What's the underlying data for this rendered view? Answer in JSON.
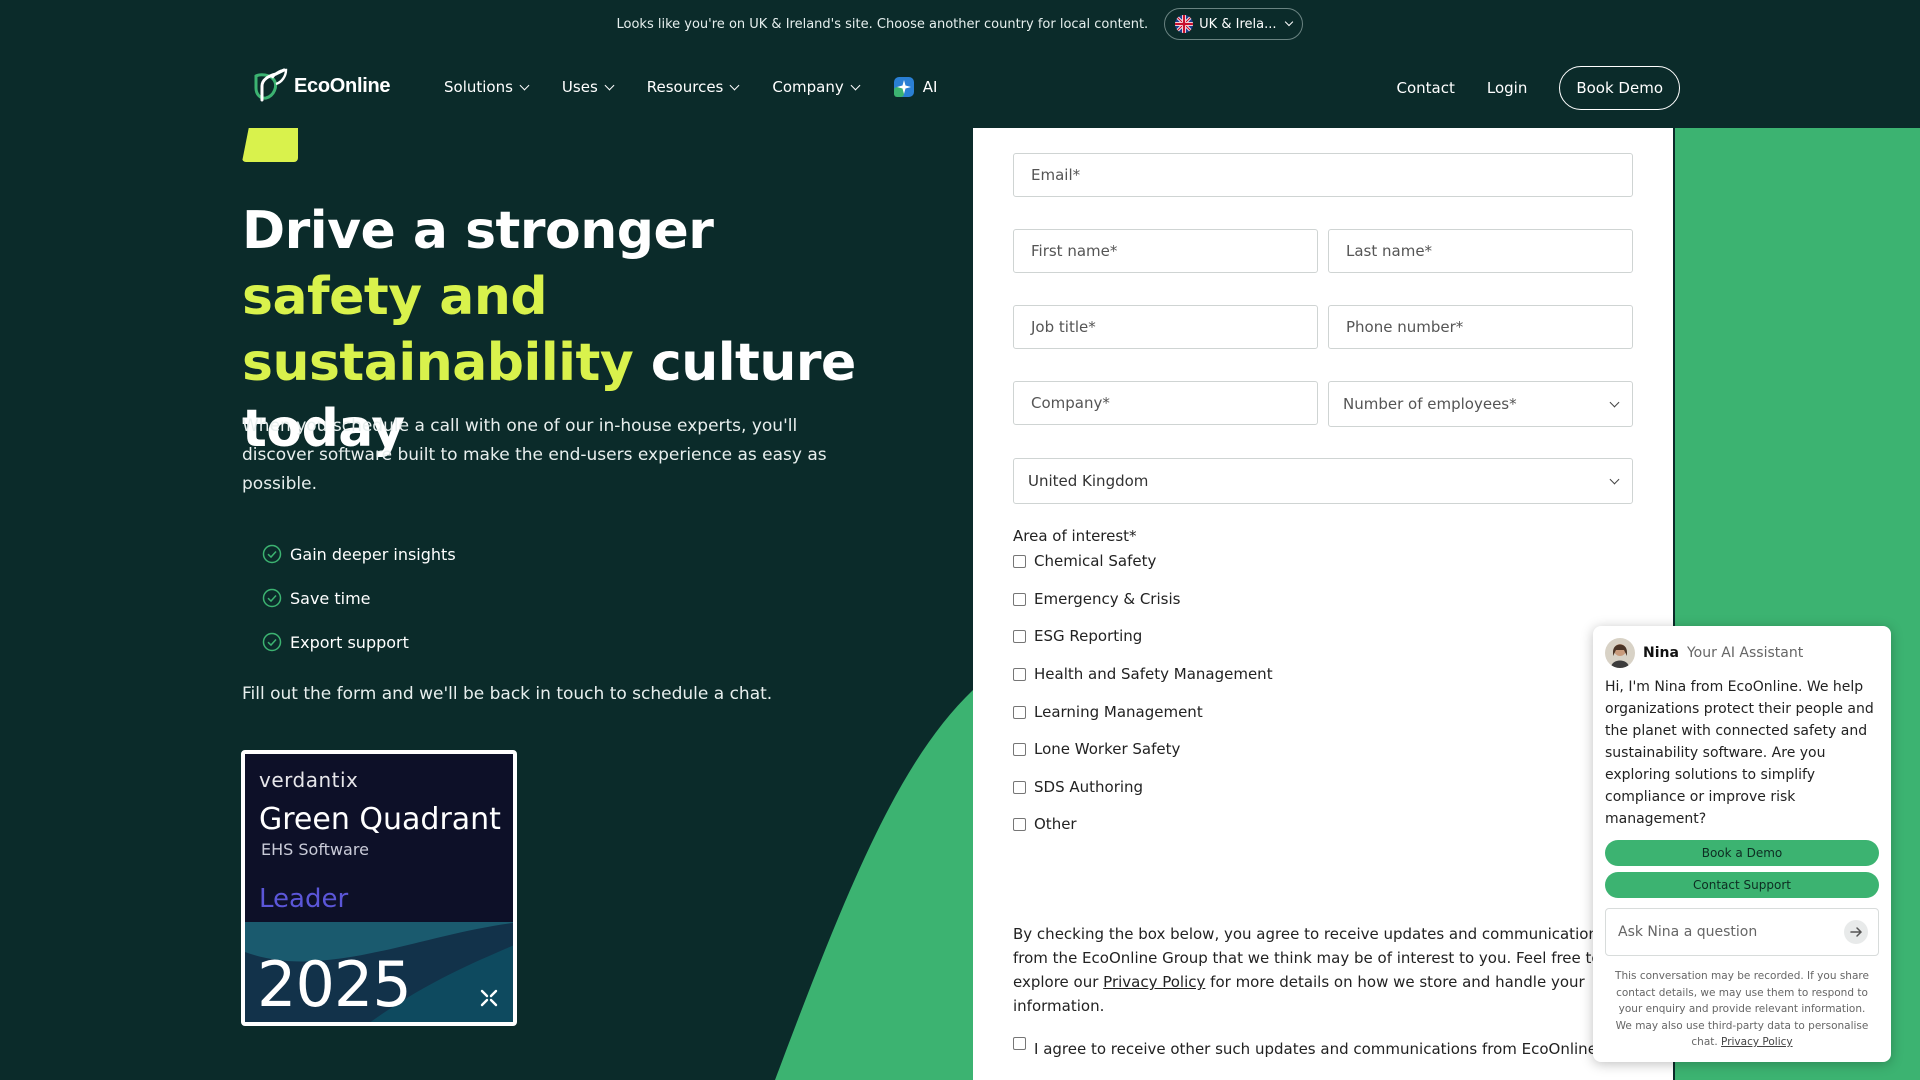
{
  "geo_bar": {
    "message": "Looks like you're on UK & Ireland's site. Choose another country for local content.",
    "country_label": "UK & Irela..."
  },
  "nav": {
    "logo_text": "EcoOnline",
    "menu": [
      {
        "label": "Solutions"
      },
      {
        "label": "Uses"
      },
      {
        "label": "Resources"
      },
      {
        "label": "Company"
      },
      {
        "label": "AI"
      }
    ],
    "contact": "Contact",
    "login": "Login",
    "book_demo": "Book Demo"
  },
  "hero": {
    "title_part1": "Drive a stronger ",
    "title_highlight": "safety and sustainability",
    "title_part2": " culture today",
    "description": "When you schedule a call with one of our in-house experts, you'll discover software built to make the end-users experience as easy as possible.",
    "benefits": [
      "Gain deeper insights",
      "Save time",
      "Export support"
    ],
    "fill_note": "Fill out the form and we'll be back in touch to schedule a chat."
  },
  "badge": {
    "brand": "verdantix",
    "title": "Green Quadrant",
    "subtitle": "EHS Software",
    "level": "Leader",
    "year": "2025"
  },
  "form": {
    "email_placeholder": "Email*",
    "first_name_placeholder": "First name*",
    "last_name_placeholder": "Last name*",
    "job_title_placeholder": "Job title*",
    "phone_placeholder": "Phone number*",
    "company_placeholder": "Company*",
    "employees_placeholder": "Number of employees*",
    "country_value": "United Kingdom",
    "area_label": "Area of interest*",
    "areas": [
      "Chemical Safety",
      "Emergency & Crisis",
      "ESG Reporting",
      "Health and Safety Management",
      "Learning Management",
      "Lone Worker Safety",
      "SDS Authoring",
      "Other"
    ],
    "consent_before": "By checking the box below, you agree to receive updates and communications from the EcoOnline Group that we think may be of interest to you. Feel free to explore our ",
    "consent_link": "Privacy Policy",
    "consent_after": " for more details on how we store and handle your information.",
    "agree_label": "I agree to receive other such updates and communications from EcoOnline"
  },
  "chat": {
    "name": "Nina",
    "role": "Your AI Assistant",
    "message": "Hi, I'm Nina from EcoOnline. We help organizations protect their people and the planet with connected safety and sustainability software. Are you exploring solutions to simplify compliance or improve risk management?",
    "book_demo": "Book a Demo",
    "contact_support": "Contact Support",
    "input_placeholder": "Ask Nina a question",
    "disclaimer": "This conversation may be recorded. If you share contact details, we may use them to respond to your enquiry and provide relevant information. We may also use third-party data to personalise chat. ",
    "privacy_link": "Privacy Policy"
  },
  "colors": {
    "background": "#0b2b2a",
    "accent_yellow": "#d9f24c",
    "accent_green": "#3cb371"
  }
}
